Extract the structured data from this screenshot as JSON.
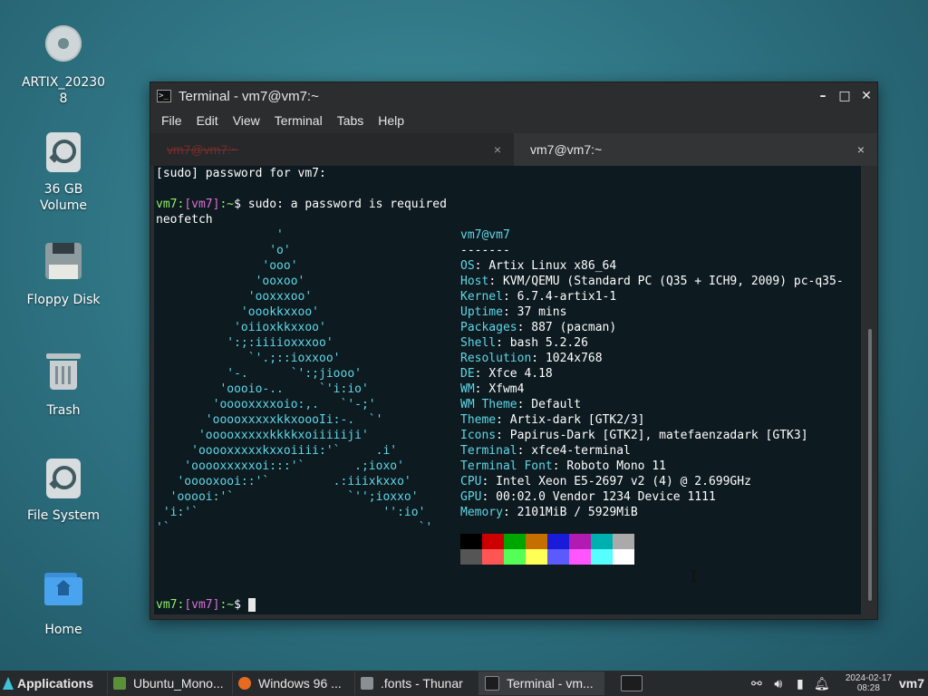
{
  "desktop": {
    "icons": [
      {
        "label": "ARTIX_20230\n8",
        "icon": "cd-disc-icon"
      },
      {
        "label": "36 GB\nVolume",
        "icon": "drive-icon"
      },
      {
        "label": "Floppy Disk",
        "icon": "floppy-icon"
      },
      {
        "label": "Trash",
        "icon": "trash-icon"
      },
      {
        "label": "File System",
        "icon": "drive-icon"
      },
      {
        "label": "Home",
        "icon": "home-folder-icon"
      }
    ]
  },
  "window": {
    "title": "Terminal - vm7@vm7:~",
    "menu": [
      "File",
      "Edit",
      "View",
      "Terminal",
      "Tabs",
      "Help"
    ],
    "tabs": [
      {
        "label": "vm7@vm7:~",
        "active": false
      },
      {
        "label": "vm7@vm7:~",
        "active": true
      }
    ],
    "close_glyph": "×"
  },
  "terminal": {
    "prompt_user": "vm7",
    "prompt_host": "vm7",
    "sudo_prompt": "[sudo] password for vm7:",
    "command1": "sudo: a password is required",
    "command2": "neofetch",
    "logo_lines": [
      "                 '",
      "                'o'",
      "               'ooo'",
      "              'ooxoo'",
      "             'ooxxxoo'",
      "            'oookkxxoo'",
      "           'oiioxkkxxoo'",
      "          ':;:iiiioxxxoo'",
      "             `'.;::ioxxoo'",
      "          '-.      `':;jiooo'",
      "         'oooio-..     `'i:io'",
      "        'ooooxxxxoio:,.   `'-;'",
      "       'ooooxxxxxkkxoooIi:-.  `'",
      "      'ooooxxxxxkkkkxoiiiiiji'",
      "     'ooooxxxxxkxxoiiii:'`     .i'",
      "    'ooooxxxxxoi:::'`       .;ioxo'",
      "   'ooooxooi::'`         .:iiixkxxo'",
      "  'ooooi:'`                `'';ioxxo'",
      " 'i:'`                          '':io'",
      "'`                                   `'"
    ],
    "user_host": "vm7@vm7",
    "separator": "-------",
    "info": [
      {
        "key": "OS",
        "value": "Artix Linux x86_64"
      },
      {
        "key": "Host",
        "value": "KVM/QEMU (Standard PC (Q35 + ICH9, 2009) pc-q35-"
      },
      {
        "key": "Kernel",
        "value": "6.7.4-artix1-1"
      },
      {
        "key": "Uptime",
        "value": "37 mins"
      },
      {
        "key": "Packages",
        "value": "887 (pacman)"
      },
      {
        "key": "Shell",
        "value": "bash 5.2.26"
      },
      {
        "key": "Resolution",
        "value": "1024x768"
      },
      {
        "key": "DE",
        "value": "Xfce 4.18"
      },
      {
        "key": "WM",
        "value": "Xfwm4"
      },
      {
        "key": "WM Theme",
        "value": "Default"
      },
      {
        "key": "Theme",
        "value": "Artix-dark [GTK2/3]"
      },
      {
        "key": "Icons",
        "value": "Papirus-Dark [GTK2], matefaenzadark [GTK3]"
      },
      {
        "key": "Terminal",
        "value": "xfce4-terminal"
      },
      {
        "key": "Terminal Font",
        "value": "Roboto Mono 11"
      },
      {
        "key": "CPU",
        "value": "Intel Xeon E5-2697 v2 (4) @ 2.699GHz"
      },
      {
        "key": "GPU",
        "value": "00:02.0 Vendor 1234 Device 1111"
      },
      {
        "key": "Memory",
        "value": "2101MiB / 5929MiB"
      }
    ],
    "palette_row1": [
      "#000000",
      "#cc0000",
      "#00a600",
      "#c46f00",
      "#1a1ad9",
      "#b21bb2",
      "#00b0b0",
      "#aaaaaa"
    ],
    "palette_row2": [
      "#555555",
      "#ff5555",
      "#55ff55",
      "#ffff55",
      "#5a5aff",
      "#ff55ff",
      "#55ffff",
      "#ffffff"
    ]
  },
  "taskbar": {
    "applications": "Applications",
    "tasks": [
      {
        "label": "Ubuntu_Mono...",
        "icon": "font-file-icon",
        "color": "#5b8f3a"
      },
      {
        "label": "Windows 96 ...",
        "icon": "firefox-icon",
        "color": "#e66a1f"
      },
      {
        "label": ".fonts - Thunar",
        "icon": "folder-icon",
        "color": "#8a8f93"
      },
      {
        "label": "Terminal - vm...",
        "icon": "terminal-icon",
        "color": "#1b1d1f"
      }
    ],
    "date": "2024-02-17",
    "time": "08:28",
    "user": "vm7"
  }
}
